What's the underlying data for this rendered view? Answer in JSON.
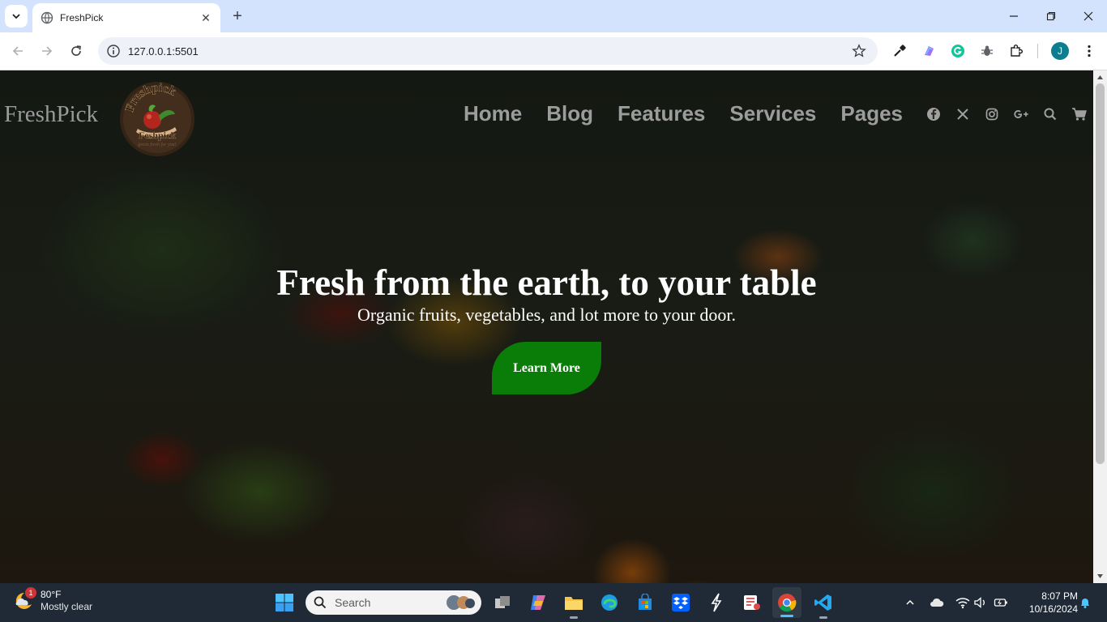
{
  "browser": {
    "tab_title": "FreshPick",
    "url": "127.0.0.1:5501",
    "profile_initial": "J"
  },
  "site": {
    "brand": "FreshPick",
    "logo_text_top": "Freshpick",
    "logo_text_bottom": "Feshpick",
    "logo_tagline": "green fresh for you!",
    "nav": [
      "Home",
      "Blog",
      "Features",
      "Services",
      "Pages"
    ],
    "nav_icons": [
      "facebook-icon",
      "x-icon",
      "instagram-icon",
      "google-plus-icon",
      "search-icon",
      "cart-icon"
    ]
  },
  "hero": {
    "title": "Fresh from the earth, to your table",
    "subtitle": "Organic fruits, vegetables, and lot more to your door.",
    "cta_label": "Learn More"
  },
  "taskbar": {
    "weather_badge": "1",
    "weather_temp": "80°F",
    "weather_condition": "Mostly clear",
    "search_placeholder": "Search",
    "time": "8:07 PM",
    "date": "10/16/2024"
  },
  "colors": {
    "accent_green": "#0a7d08",
    "tab_strip": "#d3e3fd",
    "taskbar": "#1f2a36"
  }
}
